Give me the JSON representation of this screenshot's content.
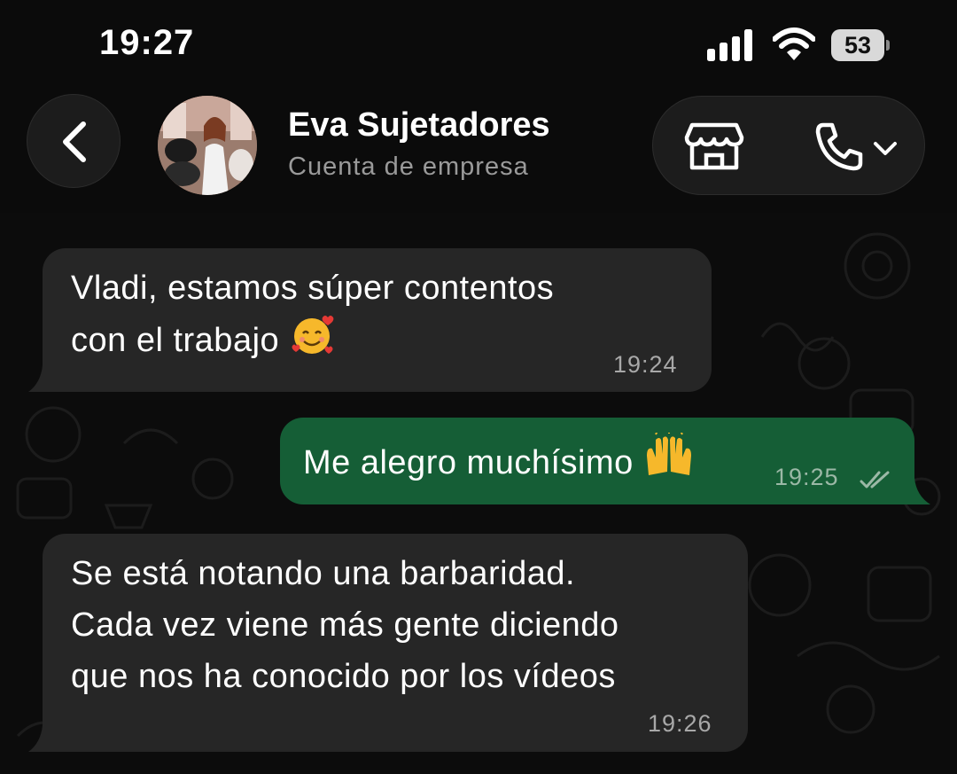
{
  "status_bar": {
    "time": "19:27",
    "battery": "53",
    "icons": [
      "signal-icon",
      "wifi-icon",
      "battery-icon"
    ]
  },
  "header": {
    "contact_name": "Eva Sujetadores",
    "contact_subtitle": "Cuenta de empresa",
    "icons": [
      "back-icon",
      "avatar",
      "store-icon",
      "phone-icon",
      "chevron-down-icon"
    ]
  },
  "messages": [
    {
      "direction": "incoming",
      "lines": [
        "Vladi, estamos súper contentos",
        "con el trabajo"
      ],
      "emoji": "smiling-face-with-hearts",
      "time": "19:24"
    },
    {
      "direction": "outgoing",
      "text": "Me alegro muchísimo",
      "emoji": "raising-hands",
      "time": "19:25",
      "status": "read"
    },
    {
      "direction": "incoming",
      "lines": [
        "Se está notando una barbaridad.",
        "Cada vez viene más gente diciendo",
        "que nos ha conocido por los vídeos"
      ],
      "time": "19:26"
    }
  ],
  "colors": {
    "background": "#0b0b0b",
    "incoming_bubble": "#262626",
    "outgoing_bubble": "#155e36",
    "timestamp": "#a8a8a8"
  }
}
